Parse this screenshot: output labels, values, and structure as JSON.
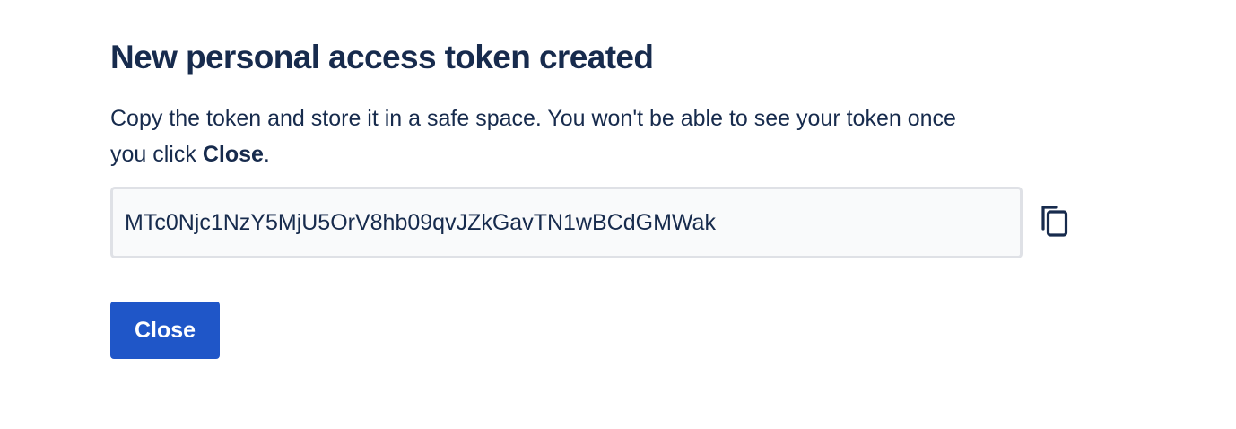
{
  "dialog": {
    "title": "New personal access token created",
    "description_prefix": "Copy the token and store it in a safe space. You won't be able to see your token once you click ",
    "description_emphasis": "Close",
    "description_suffix": ".",
    "token": {
      "value": "MTc0Njc1NzY5MjU5OrV8hb09qvJZkGavTN1wBCdGMWak"
    },
    "copy_icon": "copy-icon",
    "close_label": "Close"
  },
  "colors": {
    "text": "#172b4d",
    "primary_button": "#1f56c8",
    "field_border": "#dfe1e6",
    "field_background": "#f9fafb"
  }
}
